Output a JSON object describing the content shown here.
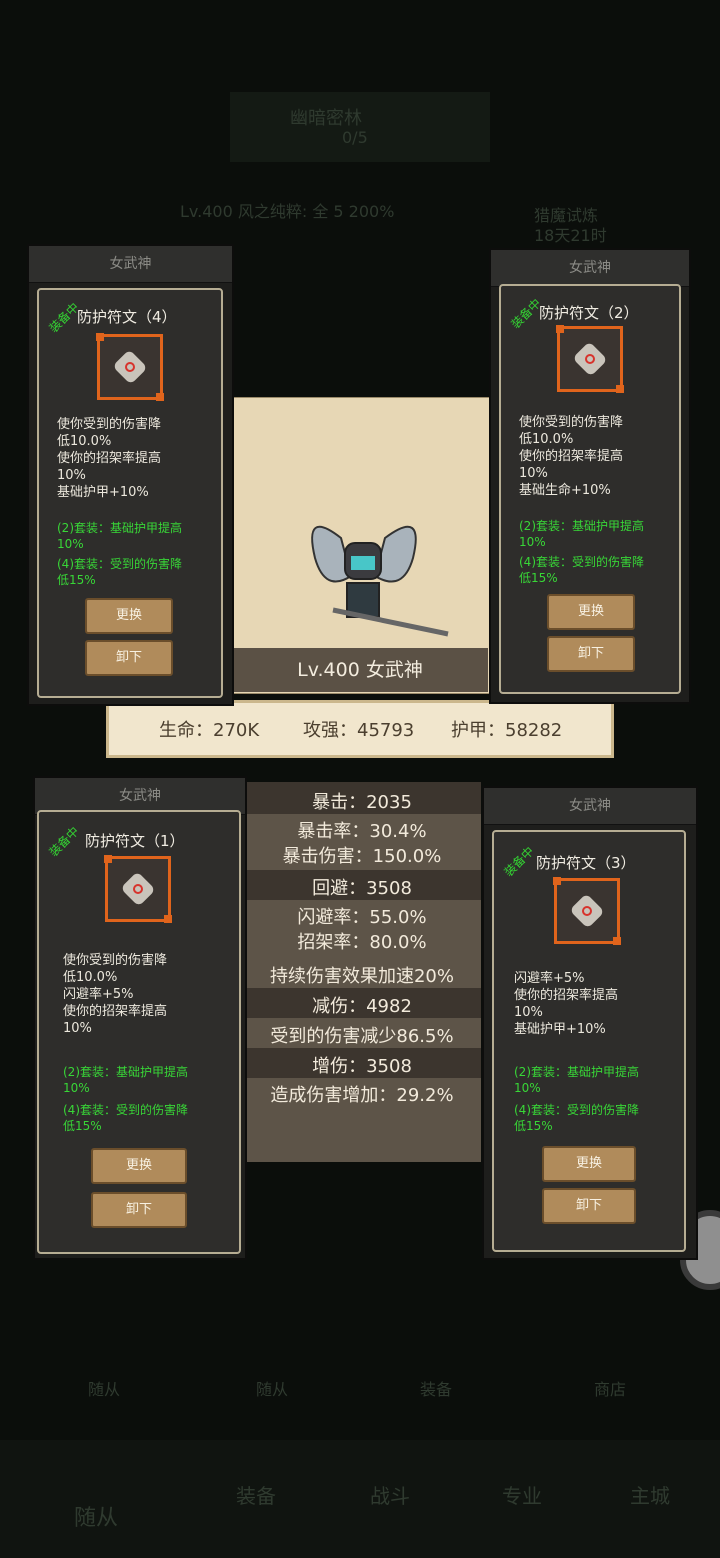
{
  "background": {
    "area_title": "幽暗密林",
    "area_progress": "0/5",
    "level_status": "Lv.400 风之纯粹: 全 5 200%",
    "event_title": "猎魔试炼",
    "event_timer": "18天21时",
    "bottom_nav": [
      "随从",
      "装备",
      "战斗",
      "专业",
      "主城"
    ],
    "bottom_tabs": [
      "随从",
      "随从",
      "装备",
      "商店"
    ]
  },
  "hero": {
    "name": "Lv.400 女武神",
    "stats": {
      "hp": "生命：270K",
      "attack": "攻强：45793",
      "armor": "护甲：58282"
    },
    "details": [
      "暴击：2035",
      "暴击率：30.4%",
      "暴击伤害：150.0%",
      "回避：3508",
      "闪避率：55.0%",
      "招架率：80.0%",
      "持续伤害效果加速20%",
      "减伤：4982",
      "受到的伤害减少86.5%",
      "增伤：3508",
      "造成伤害增加：29.2%"
    ]
  },
  "popups": [
    {
      "header": "女武神",
      "badge": "装备中",
      "item_name": "防护符文（4）",
      "desc": "使你受到的伤害降\n低10.0%\n使你的招架率提高\n10%\n基础护甲+10%",
      "set2": "(2)套装：基础护甲提高\n10%",
      "set4": "(4)套装：受到的伤害降\n低15%",
      "replace": "更换",
      "unequip": "卸下"
    },
    {
      "header": "女武神",
      "badge": "装备中",
      "item_name": "防护符文（2）",
      "desc": "使你受到的伤害降\n低10.0%\n使你的招架率提高\n10%\n基础生命+10%",
      "set2": "(2)套装：基础护甲提高\n10%",
      "set4": "(4)套装：受到的伤害降\n低15%",
      "replace": "更换",
      "unequip": "卸下"
    },
    {
      "header": "女武神",
      "badge": "装备中",
      "item_name": "防护符文（1）",
      "desc": "使你受到的伤害降\n低10.0%\n闪避率+5%\n使你的招架率提高\n10%",
      "set2": "(2)套装：基础护甲提高\n10%",
      "set4": "(4)套装：受到的伤害降\n低15%",
      "replace": "更换",
      "unequip": "卸下"
    },
    {
      "header": "女武神",
      "badge": "装备中",
      "item_name": "防护符文（3）",
      "desc": "闪避率+5%\n使你的招架率提高\n10%\n基础护甲+10%",
      "set2": "(2)套装：基础护甲提高\n10%",
      "set4": "(4)套装：受到的伤害降\n低15%",
      "replace": "更换",
      "unequip": "卸下"
    }
  ],
  "colors": {
    "accent_orange": "#e0641c",
    "set_green": "#38d637",
    "panel_border": "#b6ad93"
  }
}
